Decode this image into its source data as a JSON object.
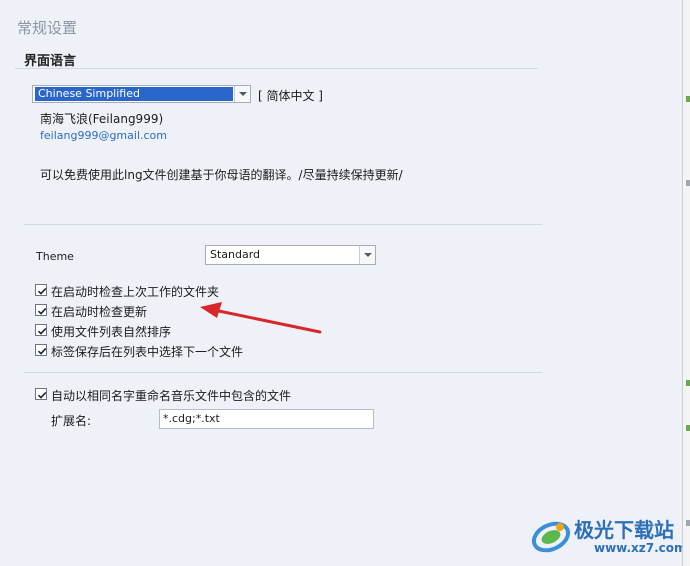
{
  "page_title": "常规设置",
  "language_section": {
    "title": "界面语言",
    "language_select_value": "Chinese Simplified",
    "language_native": "[ 简体中文 ]",
    "translator_name": "南海飞浪(Feilang999)",
    "translator_email": "feilang999@gmail.com",
    "note": "可以免费使用此lng文件创建基于你母语的翻译。/尽量持续保持更新/"
  },
  "theme": {
    "label": "Theme",
    "value": "Standard"
  },
  "options": [
    {
      "label": "在启动时检查上次工作的文件夹",
      "checked": true
    },
    {
      "label": "在启动时检查更新",
      "checked": true
    },
    {
      "label": "使用文件列表自然排序",
      "checked": true
    },
    {
      "label": "标签保存后在列表中选择下一个文件",
      "checked": true
    }
  ],
  "rename": {
    "label": "自动以相同名字重命名音乐文件中包含的文件",
    "checked": true,
    "ext_label": "扩展名:",
    "ext_value": "*.cdg;*.txt"
  },
  "watermark": {
    "brand": "极光下载站",
    "url": "www.xz7.com"
  },
  "colors": {
    "accent": "#2a66c9",
    "arrow": "#d9262b",
    "link": "#2a6ebf"
  }
}
